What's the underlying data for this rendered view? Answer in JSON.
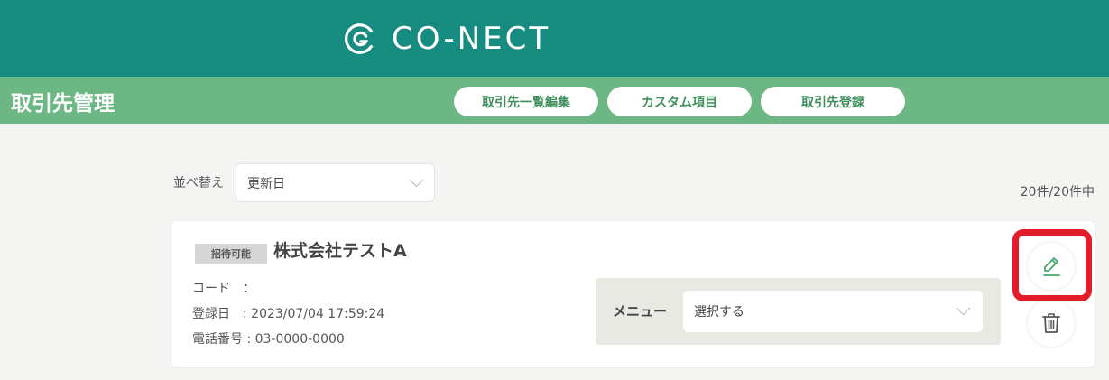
{
  "header": {
    "logo_text": "CO-NECT",
    "brand_color": "#168b80"
  },
  "sub_header": {
    "title": "取引先管理",
    "buttons": [
      {
        "label": "取引先一覧編集"
      },
      {
        "label": "カスタム項目"
      },
      {
        "label": "取引先登録"
      }
    ],
    "accent_color": "#6db785"
  },
  "sort": {
    "label": "並べ替え",
    "selected": "更新日"
  },
  "count_text": "20件/20件中",
  "card": {
    "badge": "招待可能",
    "company_name": "株式会社テストA",
    "code_line": "コード　：",
    "registered_line": "登録日　: 2023/07/04 17:59:24",
    "phone_line": "電話番号 : 03-0000-0000",
    "menu": {
      "label": "メニュー",
      "selected": "選択する"
    },
    "actions": {
      "edit_icon": "pencil-icon",
      "delete_icon": "trash-icon"
    }
  },
  "highlight_color": "#e21d2a"
}
